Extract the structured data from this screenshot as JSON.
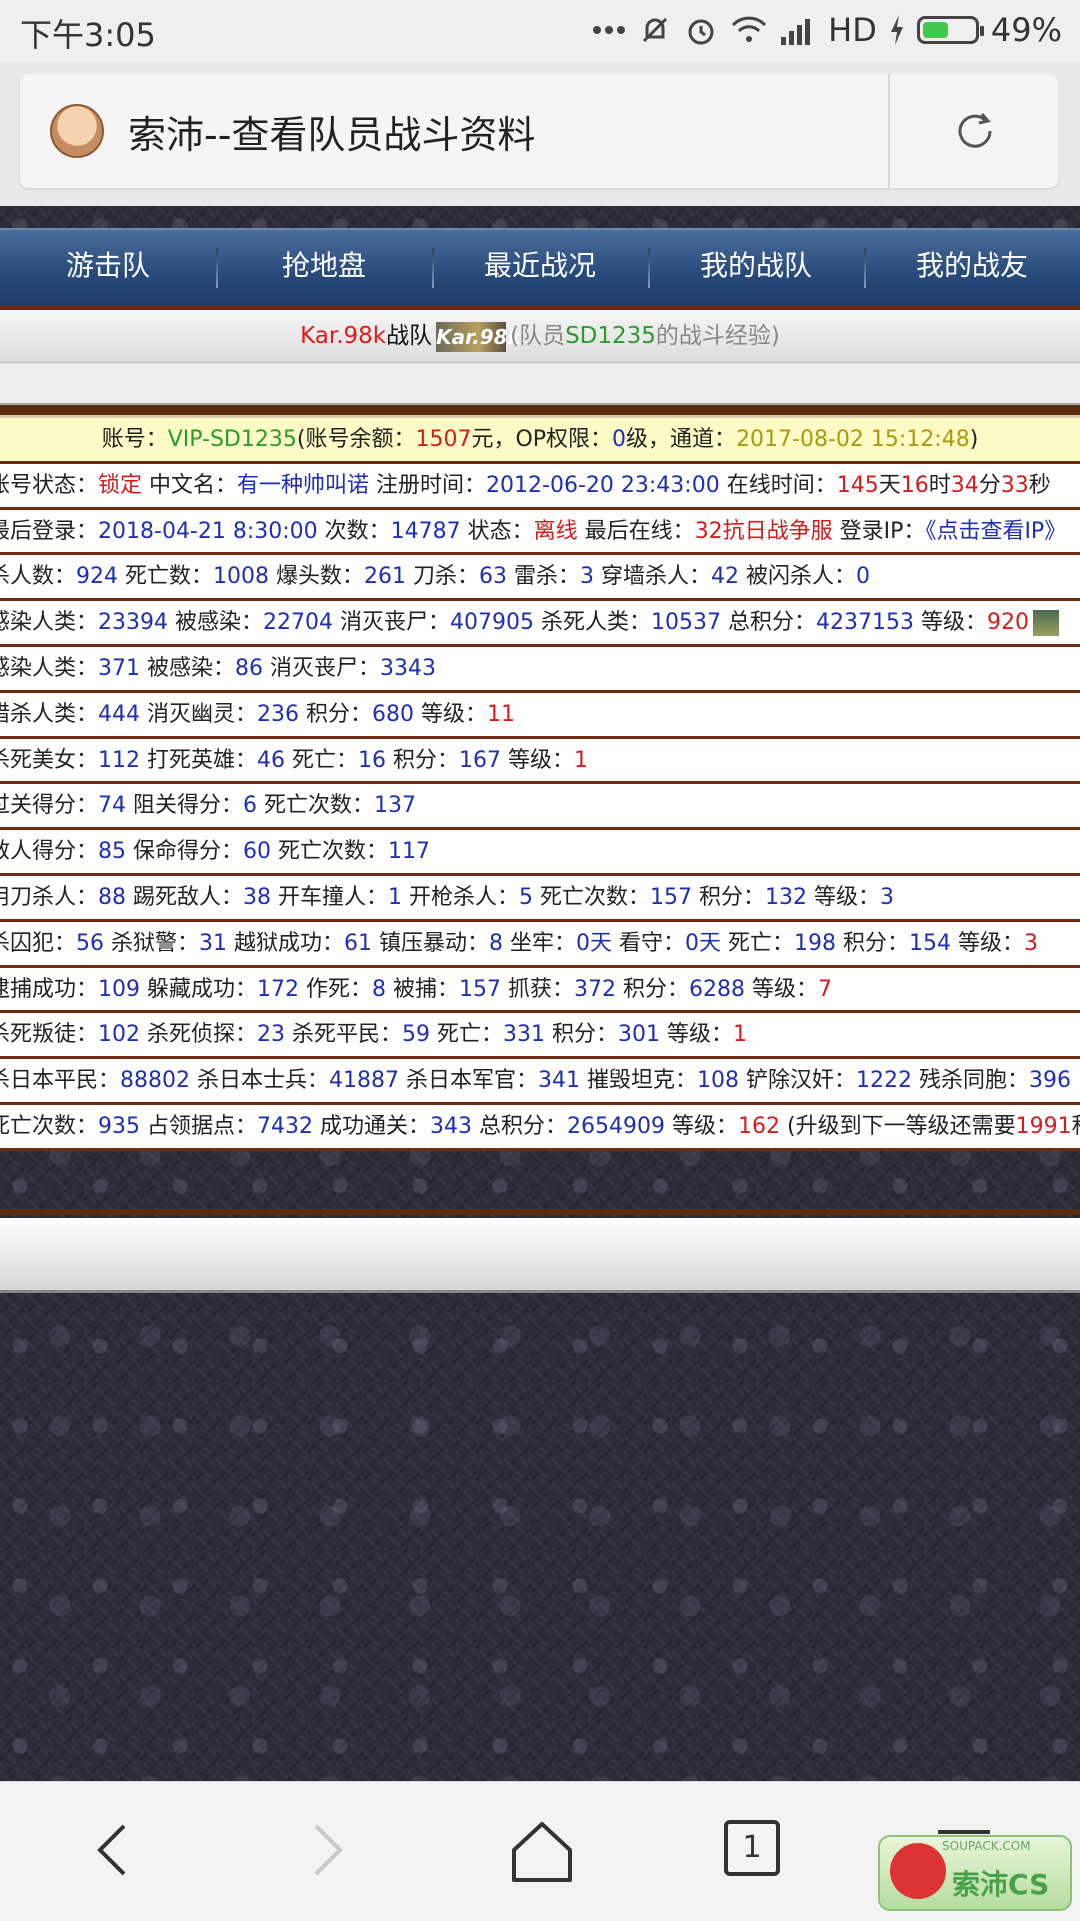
{
  "status_bar": {
    "time": "下午3:05",
    "network": "HD",
    "battery_percent": "49%",
    "battery_level": 0.49,
    "icons": [
      "more-dots-icon",
      "mute-icon",
      "alarm-icon",
      "wifi-icon",
      "signal-icon",
      "charging-icon",
      "battery-icon"
    ]
  },
  "address_bar": {
    "title": "索沛--查看队员战斗资料",
    "icons": [
      "site-avatar-icon",
      "reload-icon"
    ]
  },
  "nav": {
    "items": [
      "游击队",
      "抢地盘",
      "最近战况",
      "我的战队",
      "我的战友"
    ]
  },
  "team": {
    "team_name": "Kar.98k",
    "team_word": "战队",
    "logo_text": "Kar.98k",
    "member_prefix": "(队员",
    "member_id": "SD1235",
    "member_suffix": "的战斗经验)"
  },
  "rows": {
    "r0": {
      "a": "账号：",
      "b": "VIP-SD1235",
      "c": "(账号余额：",
      "d": "1507",
      "e": "元，OP权限：",
      "f": "0",
      "g": "级，通道：",
      "h": "2017-08-02 15:12:48",
      "i": ")"
    },
    "r1": {
      "a": "账号状态：",
      "b": "锁定",
      "c": " 中文名：",
      "d": "有一种帅叫诺",
      "e": " 注册时间：",
      "f": "2012-06-20 23:43:00",
      "g": " 在线时间：",
      "h": "145",
      "i": "天",
      "j": "16",
      "k": "时",
      "l": "34",
      "m": "分",
      "n": "33",
      "o": "秒"
    },
    "r2": {
      "a": "最后登录：",
      "b": "2018-04-21 8:30:00",
      "c": " 次数：",
      "d": "14787",
      "e": " 状态：",
      "f": "离线",
      "g": " 最后在线：",
      "h": "32抗日战争服",
      "i": " 登录IP：",
      "j": "《点击查看IP》"
    },
    "r3": {
      "a": "杀人数：",
      "b": "924",
      "c": " 死亡数：",
      "d": "1008",
      "e": " 爆头数：",
      "f": "261",
      "g": " 刀杀：",
      "h": "63",
      "i": " 雷杀：",
      "j": "3",
      "k": " 穿墙杀人：",
      "l": "42",
      "m": " 被闪杀人：",
      "n": "0"
    },
    "r4": {
      "a": "感染人类：",
      "b": "23394",
      "c": " 被感染：",
      "d": "22704",
      "e": " 消灭丧尸：",
      "f": "407905",
      "g": " 杀死人类：",
      "h": "10537",
      "i": " 总积分：",
      "j": "4237153",
      "k": " 等级：",
      "l": "920"
    },
    "r5": {
      "a": "感染人类：",
      "b": "371",
      "c": " 被感染：",
      "d": "86",
      "e": " 消灭丧尸：",
      "f": "3343"
    },
    "r6": {
      "a": "猎杀人类：",
      "b": "444",
      "c": " 消灭幽灵：",
      "d": "236",
      "e": " 积分：",
      "f": "680",
      "g": " 等级：",
      "h": "11"
    },
    "r7": {
      "a": "杀死美女：",
      "b": "112",
      "c": " 打死英雄：",
      "d": "46",
      "e": " 死亡：",
      "f": "16",
      "g": " 积分：",
      "h": "167",
      "i": " 等级：",
      "j": "1"
    },
    "r8": {
      "a": "过关得分：",
      "b": "74",
      "c": " 阻关得分：",
      "d": "6",
      "e": " 死亡次数：",
      "f": "137"
    },
    "r9": {
      "a": "救人得分：",
      "b": "85",
      "c": " 保命得分：",
      "d": "60",
      "e": " 死亡次数：",
      "f": "117"
    },
    "r10": {
      "a": "用刀杀人：",
      "b": "88",
      "c": " 踢死敌人：",
      "d": "38",
      "e": " 开车撞人：",
      "f": "1",
      "g": " 开枪杀人：",
      "h": "5",
      "i": " 死亡次数：",
      "j": "157",
      "k": " 积分：",
      "l": "132",
      "m": " 等级：",
      "n": "3"
    },
    "r11": {
      "a": "杀囚犯：",
      "b": "56",
      "c": " 杀狱警：",
      "d": "31",
      "e": " 越狱成功：",
      "f": "61",
      "g": " 镇压暴动：",
      "h": "8",
      "i": " 坐牢：",
      "j": "0天",
      "k": " 看守：",
      "l": "0天",
      "m": " 死亡：",
      "n": "198",
      "o": " 积分：",
      "p": "154",
      "q": " 等级：",
      "r": "3"
    },
    "r12": {
      "a": "逮捕成功：",
      "b": "109",
      "c": " 躲藏成功：",
      "d": "172",
      "e": " 作死：",
      "f": "8",
      "g": " 被捕：",
      "h": "157",
      "i": " 抓获：",
      "j": "372",
      "k": " 积分：",
      "l": "6288",
      "m": " 等级：",
      "n": "7"
    },
    "r13": {
      "a": "杀死叛徒：",
      "b": "102",
      "c": " 杀死侦探：",
      "d": "23",
      "e": " 杀死平民：",
      "f": "59",
      "g": " 死亡：",
      "h": "331",
      "i": " 积分：",
      "j": "301",
      "k": " 等级：",
      "l": "1"
    },
    "r14": {
      "a": "杀日本平民：",
      "b": "88802",
      "c": " 杀日本士兵：",
      "d": "41887",
      "e": " 杀日本军官：",
      "f": "341",
      "g": " 摧毁坦克：",
      "h": "108",
      "i": " 铲除汉奸：",
      "j": "1222",
      "k": " 残杀同胞：",
      "l": "396"
    },
    "r15": {
      "a": "死亡次数：",
      "b": "935",
      "c": " 占领据点：",
      "d": "7432",
      "e": " 成功通关：",
      "f": "343",
      "g": " 总积分：",
      "h": "2654909",
      "i": " 等级：",
      "j": "162",
      "k": " (升级到下一等级还需要",
      "l": "1991",
      "m": "积分)"
    }
  },
  "bottom_nav": {
    "tab_count": "1",
    "icons": [
      "back-icon",
      "forward-icon",
      "home-icon",
      "tabs-icon",
      "menu-icon"
    ]
  },
  "watermark": {
    "text": "索沛CS",
    "url_text": "SOUPACK.COM"
  }
}
